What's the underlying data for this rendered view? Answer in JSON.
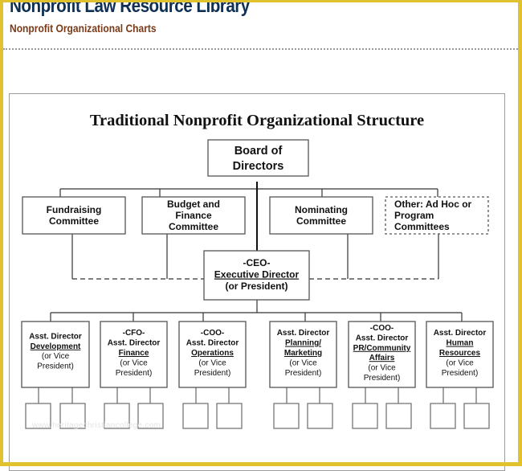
{
  "header": {
    "site_title": "Nonprofit Law Resource Library",
    "page_subtitle": "Nonprofit Organizational Charts"
  },
  "chart": {
    "title": "Traditional Nonprofit Organizational Structure",
    "board": {
      "lines": [
        {
          "text": "Board of",
          "underline": false
        },
        {
          "text": "Directors",
          "underline": false
        }
      ]
    },
    "committees": [
      {
        "id": "fundraising",
        "dashed": false,
        "align": "center",
        "lines": [
          {
            "text": "Fundraising",
            "underline": false
          },
          {
            "text": "Committee",
            "underline": false
          }
        ]
      },
      {
        "id": "budget-finance",
        "dashed": false,
        "align": "center",
        "lines": [
          {
            "text": "Budget and",
            "underline": false
          },
          {
            "text": "Finance",
            "underline": false
          },
          {
            "text": "Committee",
            "underline": false
          }
        ]
      },
      {
        "id": "nominating",
        "dashed": false,
        "align": "center",
        "lines": [
          {
            "text": "Nominating",
            "underline": false
          },
          {
            "text": "Committee",
            "underline": false
          }
        ]
      },
      {
        "id": "other-ad-hoc",
        "dashed": true,
        "align": "left",
        "lines": [
          {
            "text": "Other: Ad Hoc or",
            "underline": false
          },
          {
            "text": "Program",
            "underline": false
          },
          {
            "text": "Committees",
            "underline": false
          }
        ]
      }
    ],
    "ceo": {
      "lines": [
        {
          "text": "-CEO-",
          "underline": false,
          "bold": true
        },
        {
          "text": "Executive Director",
          "underline": true,
          "bold": true
        },
        {
          "text": "(or President)",
          "underline": false,
          "bold": true
        }
      ]
    },
    "directors": [
      {
        "id": "development",
        "lines": [
          {
            "text": "Asst. Director",
            "bold": true,
            "underline": false
          },
          {
            "text": "Development",
            "bold": true,
            "underline": true
          },
          {
            "text": "(or Vice",
            "bold": false,
            "underline": false
          },
          {
            "text": "President)",
            "bold": false,
            "underline": false
          }
        ],
        "subordinates": 2
      },
      {
        "id": "finance",
        "lines": [
          {
            "text": "-CFO-",
            "bold": true,
            "underline": false
          },
          {
            "text": "Asst. Director",
            "bold": true,
            "underline": false
          },
          {
            "text": "Finance",
            "bold": true,
            "underline": true
          },
          {
            "text": "(or Vice",
            "bold": false,
            "underline": false
          },
          {
            "text": "President)",
            "bold": false,
            "underline": false
          }
        ],
        "subordinates": 2
      },
      {
        "id": "operations",
        "lines": [
          {
            "text": "-COO-",
            "bold": true,
            "underline": false
          },
          {
            "text": "Asst. Director",
            "bold": true,
            "underline": false
          },
          {
            "text": "Operations",
            "bold": true,
            "underline": true
          },
          {
            "text": "(or Vice",
            "bold": false,
            "underline": false
          },
          {
            "text": "President)",
            "bold": false,
            "underline": false
          }
        ],
        "subordinates": 2
      },
      {
        "id": "planning-marketing",
        "lines": [
          {
            "text": "Asst. Director",
            "bold": true,
            "underline": false
          },
          {
            "text": "Planning/",
            "bold": true,
            "underline": true
          },
          {
            "text": "Marketing",
            "bold": true,
            "underline": true
          },
          {
            "text": "(or Vice",
            "bold": false,
            "underline": false
          },
          {
            "text": "President)",
            "bold": false,
            "underline": false
          }
        ],
        "subordinates": 2
      },
      {
        "id": "pr-community-affairs",
        "lines": [
          {
            "text": "-COO-",
            "bold": true,
            "underline": false
          },
          {
            "text": "Asst. Director",
            "bold": true,
            "underline": false
          },
          {
            "text": "PR/Community",
            "bold": true,
            "underline": true
          },
          {
            "text": "Affairs",
            "bold": true,
            "underline": true
          },
          {
            "text": "(or Vice",
            "bold": false,
            "underline": false
          },
          {
            "text": "President)",
            "bold": false,
            "underline": false
          }
        ],
        "subordinates": 2
      },
      {
        "id": "human-resources",
        "lines": [
          {
            "text": "Asst. Director",
            "bold": true,
            "underline": false
          },
          {
            "text": "Human",
            "bold": true,
            "underline": true
          },
          {
            "text": "Resources",
            "bold": true,
            "underline": true
          },
          {
            "text": "(or Vice",
            "bold": false,
            "underline": false
          },
          {
            "text": "President)",
            "bold": false,
            "underline": false
          }
        ],
        "subordinates": 2
      }
    ]
  },
  "watermark": "www.heritagechristiancollege.com"
}
